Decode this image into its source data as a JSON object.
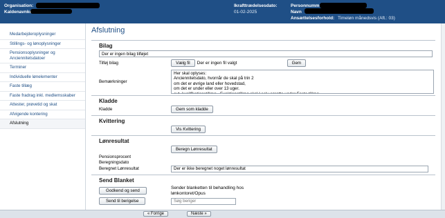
{
  "header": {
    "org_label": "Organisation:",
    "account_label": "Kaldenavnkort:",
    "effective_label": "Ikrafttrædelsesdato:",
    "effective_value": "01-02-2025",
    "person_label": "Personnumm",
    "name_label": "Navn",
    "employment_label": "Ansættelsesforhold:",
    "employment_value": "Timeløn månedsvis (Aft.: 03)"
  },
  "sidebar": {
    "items": [
      {
        "label": "Medarbejderoplysninger"
      },
      {
        "label": "Stillings- og lønoplysninger"
      },
      {
        "label": "Pensionsoplysninger og Anciennitetsdatoer"
      },
      {
        "label": "Terminer"
      },
      {
        "label": "Individuelle lønelementer"
      },
      {
        "label": "Faste tillæg"
      },
      {
        "label": "Faste fradrag inkl. medlemsskaber"
      },
      {
        "label": "Attester, prøvetid og skat"
      },
      {
        "label": "Afvigende kontering"
      },
      {
        "label": "Afslutning"
      }
    ]
  },
  "main": {
    "title": "Afslutning",
    "bilag": {
      "heading": "Bilag",
      "status": "Der er ingen bilag tilføjet",
      "add_label": "Tilføj bilag",
      "choose_button": "Vælg fil",
      "no_file": "Der er ingen fil valgt",
      "save_button": "Gem",
      "remarks_label": "Bemærkninger",
      "remarks_value": "Her skal oplyses:\nAnciennitetsdato, hvornår de skal på trin 2\nom det er øvrige land eller hovedstad,\nom det er under eller over 13 uger.\nevt. kvalifikationstillæg - Funktionstillæg skal I selv oprette under Faste tillæg"
    },
    "kladde": {
      "heading": "Kladde",
      "label": "Kladde",
      "button": "Gem som kladde"
    },
    "kvittering": {
      "heading": "Kvittering",
      "button": "Vis Kvittering"
    },
    "loenresultat": {
      "heading": "Lønresultat",
      "button": "Beregn Lønresultat",
      "pension_label": "Pensionsprocent",
      "calc_date_label": "Beregningsdato",
      "result_label": "Beregnet Lønresultat",
      "result_value": "Der er ikke beregnet noget lønresultat"
    },
    "send": {
      "heading": "Send Blanket",
      "approve_button": "Godkend og send",
      "approve_text": "Sender blanketten til behandling hos lønkontoret/Opus",
      "approver_button": "Send til berigelse",
      "search_placeholder": "Søg beriger"
    }
  },
  "footer": {
    "prev_button": "« Forrige",
    "next_button": "Næste »"
  },
  "colors": {
    "header_bg": "#1f4f86",
    "link": "#1f4f86"
  }
}
